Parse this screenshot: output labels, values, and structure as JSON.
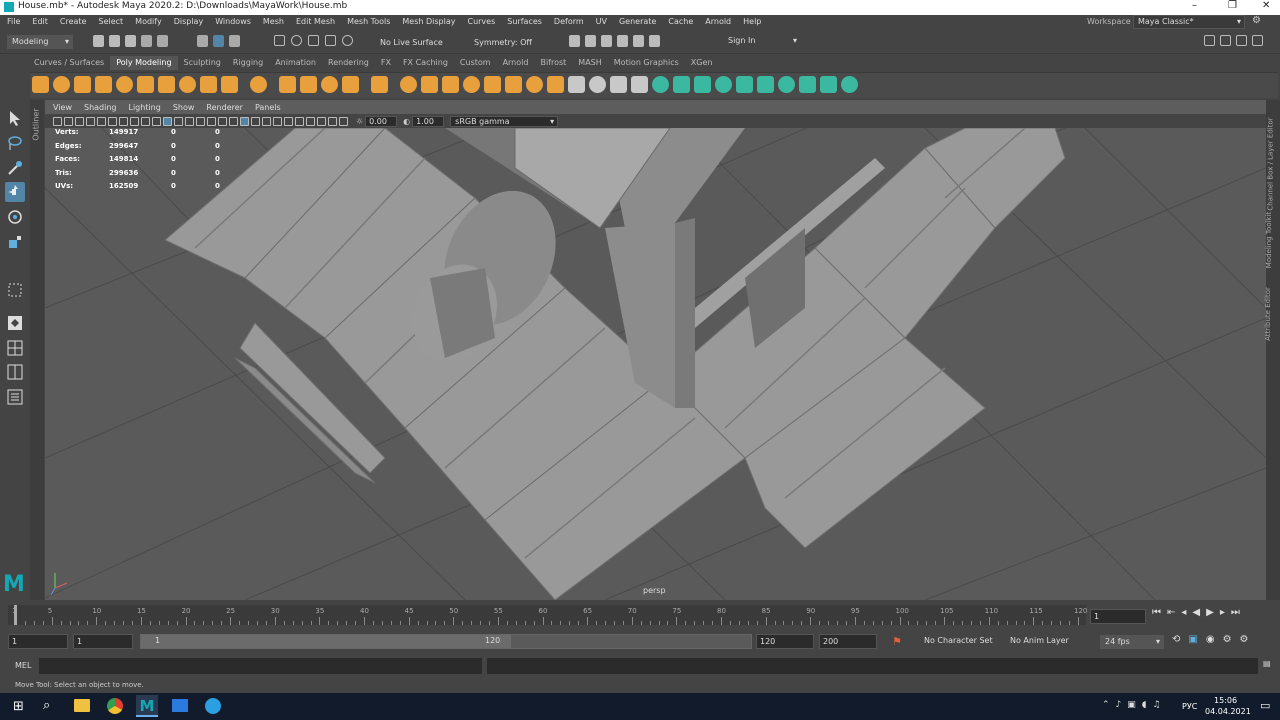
{
  "title_bar": {
    "title": "House.mb* - Autodesk Maya 2020.2: D:\\Downloads\\MayaWork\\House.mb",
    "min": "–",
    "max": "❐",
    "close": "✕"
  },
  "menu": [
    "File",
    "Edit",
    "Create",
    "Select",
    "Modify",
    "Display",
    "Windows",
    "Mesh",
    "Edit Mesh",
    "Mesh Tools",
    "Mesh Display",
    "Curves",
    "Surfaces",
    "Deform",
    "UV",
    "Generate",
    "Cache",
    "Arnold",
    "Help"
  ],
  "workspace": {
    "label": "Workspace :",
    "value": "Maya Classic*"
  },
  "status_line": {
    "mode": "Modeling",
    "live_surface": "No Live Surface",
    "symmetry": "Symmetry: Off",
    "sign_in": "Sign In"
  },
  "shelf_tabs": [
    "Curves / Surfaces",
    "Poly Modeling",
    "Sculpting",
    "Rigging",
    "Animation",
    "Rendering",
    "FX",
    "FX Caching",
    "Custom",
    "Arnold",
    "Bifrost",
    "MASH",
    "Motion Graphics",
    "XGen"
  ],
  "active_shelf": "Poly Modeling",
  "panel_menu": [
    "View",
    "Shading",
    "Lighting",
    "Show",
    "Renderer",
    "Panels"
  ],
  "viewport_toolbar": {
    "exposure": "0.00",
    "gamma": "1.00",
    "color_space": "sRGB gamma"
  },
  "hud": [
    {
      "label": "Verts:",
      "v1": "149917",
      "v2": "0",
      "v3": "0"
    },
    {
      "label": "Edges:",
      "v1": "299647",
      "v2": "0",
      "v3": "0"
    },
    {
      "label": "Faces:",
      "v1": "149814",
      "v2": "0",
      "v3": "0"
    },
    {
      "label": "Tris:",
      "v1": "299636",
      "v2": "0",
      "v3": "0"
    },
    {
      "label": "UVs:",
      "v1": "162509",
      "v2": "0",
      "v3": "0"
    }
  ],
  "camera_label": "persp",
  "outliner_tab": "Outliner",
  "right_tabs": [
    "Channel Box / Layer Editor",
    "Modeling Toolkit",
    "Attribute Editor"
  ],
  "timeline": {
    "ticks": [
      "1",
      "5",
      "10",
      "15",
      "20",
      "25",
      "30",
      "35",
      "40",
      "45",
      "50",
      "55",
      "60",
      "65",
      "70",
      "75",
      "80",
      "85",
      "90",
      "95",
      "100",
      "105",
      "110",
      "115",
      "120"
    ],
    "current_frame": "1"
  },
  "range": {
    "start": "1",
    "anim_start": "1",
    "range_start": "1",
    "range_end": "120",
    "anim_end": "120",
    "end": "200",
    "char_set": "No Character Set",
    "anim_layer": "No Anim Layer",
    "fps": "24 fps"
  },
  "cmd": {
    "label": "MEL"
  },
  "help_line": "Move Tool: Select an object to move.",
  "taskbar": {
    "time": "15:06",
    "date": "04.04.2021",
    "lang": "РУС"
  },
  "colors": {
    "accent": "#5285a6",
    "shelf_orange": "#e8a03c",
    "shelf_green": "#3bb8a0",
    "maya_teal": "#12a8b5"
  }
}
